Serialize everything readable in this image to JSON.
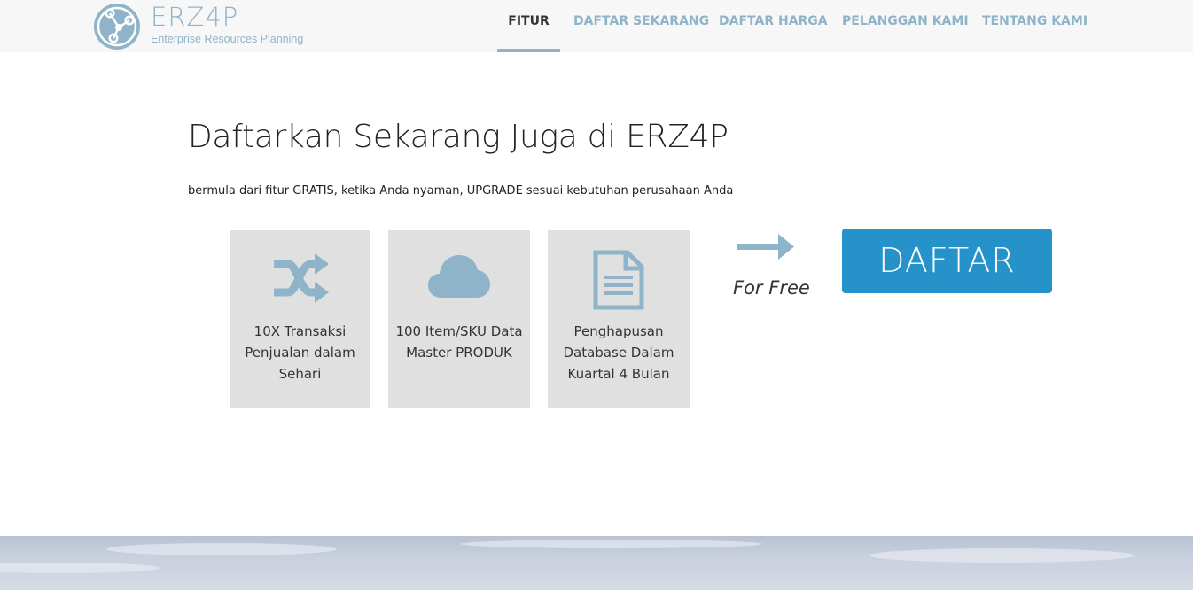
{
  "header": {
    "logo": {
      "word": "ERZ4P",
      "tagline": "Enterprise Resources Planning"
    },
    "nav": [
      {
        "label": "FITUR",
        "active": true
      },
      {
        "label": "DAFTAR SEKARANG",
        "active": false
      },
      {
        "label": "DAFTAR HARGA",
        "active": false
      },
      {
        "label": "PELANGGAN KAMI",
        "active": false
      },
      {
        "label": "TENTANG KAMI",
        "active": false
      }
    ]
  },
  "main": {
    "headline": "Daftarkan Sekarang Juga di ERZ4P",
    "subline": "bermula dari fitur GRATIS, ketika Anda nyaman, UPGRADE sesuai kebutuhan perusahaan Anda",
    "features": [
      {
        "icon": "shuffle-icon",
        "text": "10X Transaksi Penjualan dalam Sehari"
      },
      {
        "icon": "cloud-icon",
        "text": "100 Item/SKU Data Master PRODUK"
      },
      {
        "icon": "document-icon",
        "text": "Penghapusan Database Dalam Kuartal 4 Bulan"
      }
    ],
    "for_free": "For Free",
    "cta_label": "DAFTAR"
  },
  "colors": {
    "accent": "#8fb4c9",
    "cta": "#2592c9",
    "tile": "#e0e0e0",
    "topbar": "#f7f7f7"
  }
}
